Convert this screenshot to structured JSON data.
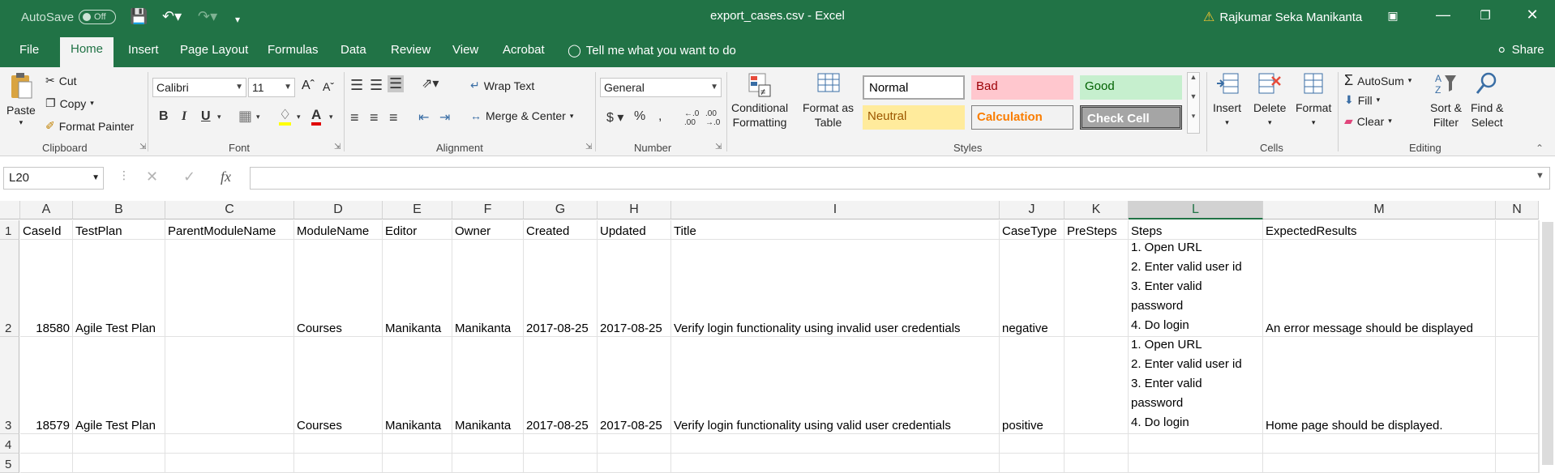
{
  "titlebar": {
    "autosave_label": "AutoSave",
    "autosave_state": "Off",
    "document_title": "export_cases.csv  -  Excel",
    "user_name": "Rajkumar Seka Manikanta"
  },
  "tabs": [
    "File",
    "Home",
    "Insert",
    "Page Layout",
    "Formulas",
    "Data",
    "Review",
    "View",
    "Acrobat"
  ],
  "active_tab": "Home",
  "tell_me": "Tell me what you want to do",
  "share_label": "Share",
  "clipboard": {
    "paste": "Paste",
    "cut": "Cut",
    "copy": "Copy",
    "format_painter": "Format Painter",
    "label": "Clipboard"
  },
  "font": {
    "name": "Calibri",
    "size": "11",
    "label": "Font"
  },
  "alignment": {
    "wrap_text": "Wrap Text",
    "merge_center": "Merge & Center",
    "label": "Alignment"
  },
  "number": {
    "format": "General",
    "label": "Number"
  },
  "styles": {
    "conditional_1": "Conditional",
    "conditional_2": "Formatting",
    "format_as_1": "Format as",
    "format_as_2": "Table",
    "normal": "Normal",
    "bad": "Bad",
    "good": "Good",
    "neutral": "Neutral",
    "calculation": "Calculation",
    "check_cell": "Check Cell",
    "label": "Styles"
  },
  "cells_group": {
    "insert": "Insert",
    "delete": "Delete",
    "format": "Format",
    "label": "Cells"
  },
  "editing": {
    "autosum": "AutoSum",
    "fill": "Fill",
    "clear": "Clear",
    "sort_1": "Sort &",
    "sort_2": "Filter",
    "find_1": "Find &",
    "find_2": "Select",
    "label": "Editing"
  },
  "formula_bar": {
    "name_box": "L20",
    "fx": "fx",
    "formula": ""
  },
  "sheet": {
    "columns": [
      "A",
      "B",
      "C",
      "D",
      "E",
      "F",
      "G",
      "H",
      "I",
      "J",
      "K",
      "L",
      "M",
      "N"
    ],
    "selected_column": "L",
    "row_numbers": [
      "1",
      "2",
      "3",
      "4",
      "5"
    ],
    "header_row": [
      "CaseId",
      "TestPlan",
      "ParentModuleName",
      "ModuleName",
      "Editor",
      "Owner",
      "Created",
      "Updated",
      "Title",
      "CaseType",
      "PreSteps",
      "Steps",
      "ExpectedResults",
      ""
    ],
    "rows": [
      [
        "18580",
        "Agile Test Plan",
        "",
        "Courses",
        "Manikanta",
        "Manikanta",
        "2017-08-25",
        "2017-08-25",
        "Verify login functionality using invalid user credentials",
        "negative",
        "",
        "1. Open URL\n2. Enter valid user id\n3. Enter valid\npassword\n4. Do login",
        "An error message should be displayed",
        ""
      ],
      [
        "18579",
        "Agile Test Plan",
        "",
        "Courses",
        "Manikanta",
        "Manikanta",
        "2017-08-25",
        "2017-08-25",
        "Verify login functionality using valid user credentials",
        "positive",
        "",
        "1. Open URL\n2. Enter valid user id\n3. Enter valid\npassword\n4. Do login",
        "Home page should be displayed.",
        ""
      ]
    ]
  }
}
